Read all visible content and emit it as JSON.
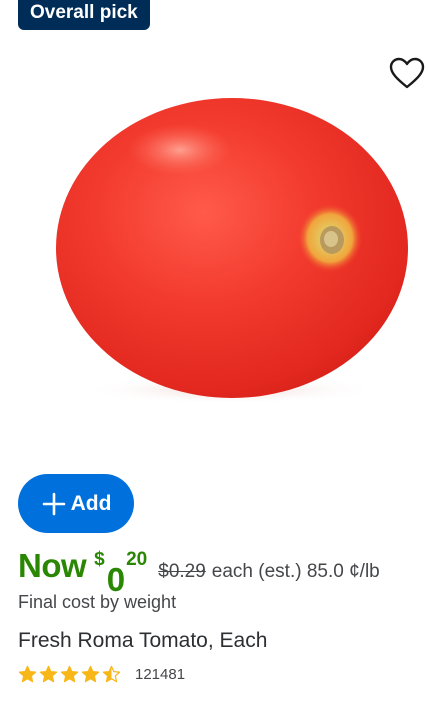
{
  "badge": {
    "label": "Overall pick"
  },
  "favorite": {
    "icon": "heart-outline-icon"
  },
  "product": {
    "image_alt": "Fresh Roma Tomato",
    "title": "Fresh Roma Tomato, Each",
    "final_cost_note": "Final cost by weight"
  },
  "add_button": {
    "label": "Add",
    "icon": "plus-icon"
  },
  "price": {
    "now_label": "Now",
    "currency": "$",
    "dollars": "0",
    "cents": "20",
    "was": "$0.29",
    "unit_text": "each (est.) 85.0 ¢/lb"
  },
  "rating": {
    "stars": 4.5,
    "max_stars": 5,
    "review_count": "121481"
  },
  "colors": {
    "badge_bg": "#002d58",
    "add_button_bg": "#0071dc",
    "price_green": "#2a8703",
    "star_fill": "#f8b719"
  }
}
